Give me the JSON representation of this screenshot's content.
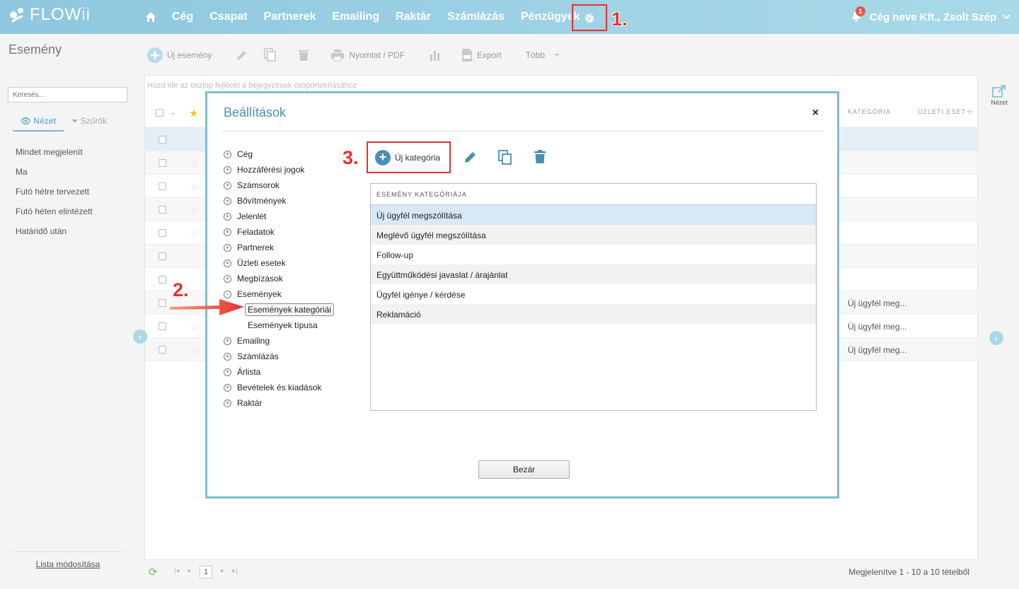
{
  "app": {
    "brand": "FLOWii",
    "accent": "#4a8fb4",
    "annotation_color": "#e5312f"
  },
  "nav": {
    "items": [
      "Cég",
      "Csapat",
      "Partnerek",
      "Emailing",
      "Raktár",
      "Számlázás",
      "Pénzügyek"
    ],
    "user": "Cég neve Kft., Zsolt Szép",
    "notifications": "1"
  },
  "annotations": {
    "step1": "1.",
    "step2": "2.",
    "step3": "3."
  },
  "page": {
    "title": "Esemény"
  },
  "sidebar": {
    "search_placeholder": "Keresés...",
    "tab_view": "Nézet",
    "tab_filters": "Szűrők",
    "items": [
      "Mindet megjelenít",
      "Ma",
      "Futó hétre tervezett",
      "Futó héten elintézett",
      "Határidő után"
    ],
    "footer": "Lista módosítása"
  },
  "toolbar": {
    "new": "Új esemény",
    "print": "Nyomtat / PDF",
    "export": "Export",
    "more": "Több"
  },
  "grid": {
    "group_hint": "Húzd ide az oszlop fejlécét a bejegyzések csoportosításához",
    "col_category": "KATEGÓRIA",
    "col_business": "ÜZLETI ESET",
    "row_categories": [
      "Új ügyfél meg...",
      "Új ügyfél meg...",
      "Új ügyfél meg..."
    ]
  },
  "pager": {
    "page": "1",
    "info": "Megjelenítve 1 - 10 a 10 tételből"
  },
  "right_panel": {
    "view": "Nézet"
  },
  "modal": {
    "title": "Beállítások",
    "close_x": "×",
    "tree": [
      {
        "label": "Cég",
        "sign": "+"
      },
      {
        "label": "Hozzáférési jogok",
        "sign": "+"
      },
      {
        "label": "Számsorok",
        "sign": "+"
      },
      {
        "label": "Bővítmények",
        "sign": "+"
      },
      {
        "label": "Jelenlét",
        "sign": "+"
      },
      {
        "label": "Feladatok",
        "sign": "+"
      },
      {
        "label": "Partnerek",
        "sign": "+"
      },
      {
        "label": "Üzleti esetek",
        "sign": "+"
      },
      {
        "label": "Megbízások",
        "sign": "+"
      },
      {
        "label": "Események",
        "sign": "−"
      }
    ],
    "tree_sub": [
      "Események kategóriái",
      "Események típusa"
    ],
    "tree_after": [
      {
        "label": "Emailing",
        "sign": "+"
      },
      {
        "label": "Számlázás",
        "sign": "+"
      },
      {
        "label": "Árlista",
        "sign": "+"
      },
      {
        "label": "Bevételek és kiadások",
        "sign": "+"
      },
      {
        "label": "Raktár",
        "sign": "+"
      }
    ],
    "new_category": "Új kategória",
    "table_header": "ESEMÉNY KATEGÓRIÁJA",
    "categories": [
      "Új ügyfél megszólítása",
      "Meglévő ügyfél megszólítása",
      "Follow-up",
      "Együttműködési javaslat / árajánlat",
      "Ügyfél igénye / kérdése",
      "Reklamáció"
    ],
    "close_button": "Bezár"
  }
}
